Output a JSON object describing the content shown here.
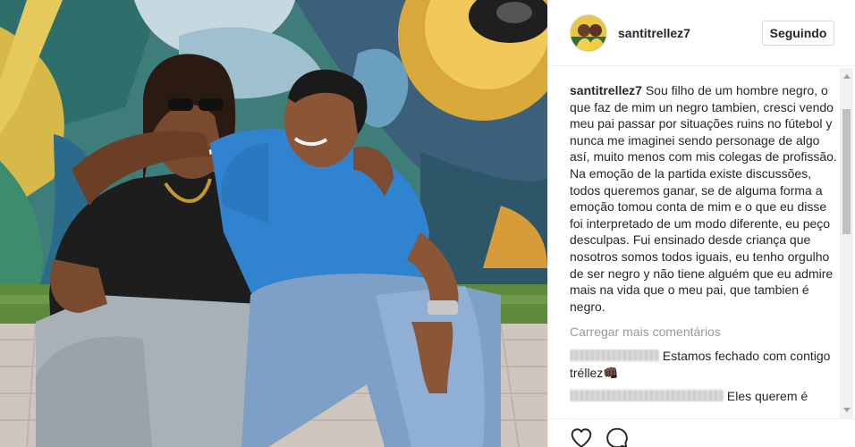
{
  "post": {
    "username": "santitrellez7",
    "follow_label": "Seguindo",
    "caption_user": "santitrellez7",
    "caption_text": "Sou filho de um hombre negro, o que faz de mim un negro tambien, cresci vendo meu pai passar por situações ruins no fútebol y nunca me imaginei sendo personage de algo así, muito menos com mis colegas de profissão. Na emoção de la partida existe discussões, todos queremos ganar, se de alguma forma a emoção tomou conta de mim e o que eu disse foi interpretado de um modo diferente, eu peço desculpas. Fui ensinado desde criança que nosotros somos todos iguais, eu tenho orgulho de ser negro y não tiene alguém que eu admire mais na vida que o meu pai, que tambien é negro.",
    "load_more_label": "Carregar mais comentários"
  },
  "comments": [
    {
      "text": "Estamos fechado com contigo tréllez👊🏿"
    },
    {
      "text": "Eles querem é"
    }
  ],
  "icons": {
    "like": "heart-icon",
    "comment": "comment-icon"
  },
  "colors": {
    "text": "#262626",
    "muted": "#999999",
    "border": "#dbdbdb"
  }
}
